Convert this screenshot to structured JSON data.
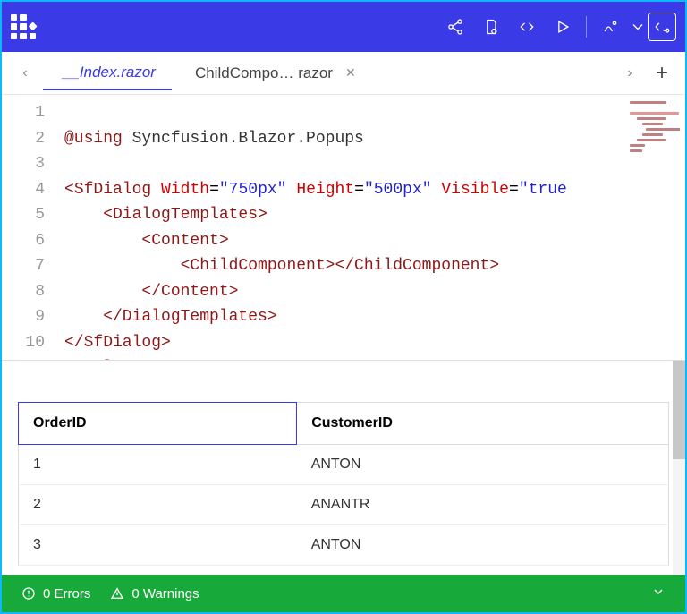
{
  "toolbar": {
    "icons": [
      "share",
      "settings-file",
      "code",
      "run",
      "format",
      "settings-panel"
    ]
  },
  "tabs": {
    "prev": "‹",
    "next": "›",
    "add": "+",
    "items": [
      {
        "label": "__Index.razor",
        "active": true,
        "closable": false
      },
      {
        "label": "ChildCompo… razor",
        "active": false,
        "closable": true
      }
    ]
  },
  "editor": {
    "lines": [
      "1",
      "2",
      "3",
      "4",
      "5",
      "6",
      "7",
      "8",
      "9",
      "10"
    ],
    "code": {
      "l1_at": "@using",
      "l1_rest": " Syncfusion.Blazor.Popups",
      "l3_open": "<",
      "l3_tag": "SfDialog",
      "l3_a1": "Width",
      "l3_v1": "\"750px\"",
      "l3_a2": "Height",
      "l3_v2": "\"500px\"",
      "l3_a3": "Visible",
      "l3_v3": "\"true",
      "l4": "    <DialogTemplates>",
      "l5": "        <Content>",
      "l6": "            <ChildComponent></ChildComponent>",
      "l7": "        </Content>",
      "l8": "    </DialogTemplates>",
      "l9": "</SfDialog>",
      "l10": "<style>"
    }
  },
  "preview": {
    "columns": [
      "OrderID",
      "CustomerID"
    ],
    "rows": [
      {
        "OrderID": "1",
        "CustomerID": "ANTON"
      },
      {
        "OrderID": "2",
        "CustomerID": "ANANTR"
      },
      {
        "OrderID": "3",
        "CustomerID": "ANTON"
      }
    ]
  },
  "status": {
    "errors": "0 Errors",
    "warnings": "0 Warnings"
  }
}
